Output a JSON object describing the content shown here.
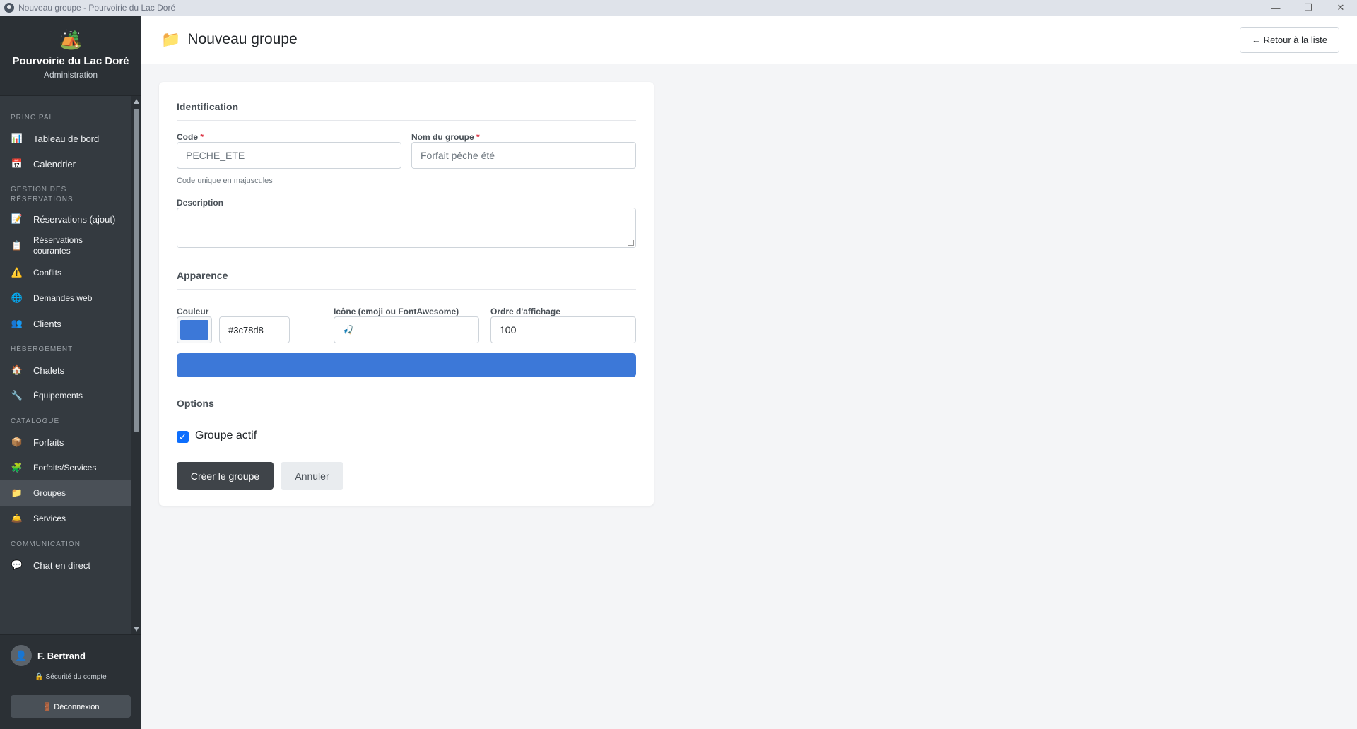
{
  "window": {
    "title": "Nouveau groupe - Pourvoirie du Lac Doré",
    "minimize": "—",
    "maximize": "❐",
    "close": "✕"
  },
  "brand": {
    "logo": "🏕️",
    "name": "Pourvoirie du Lac Doré",
    "subtitle": "Administration"
  },
  "sidebar": {
    "sections": {
      "principal": "PRINCIPAL",
      "reservations": "GESTION DES RÉSERVATIONS",
      "hebergement": "HÉBERGEMENT",
      "catalogue": "CATALOGUE",
      "communication": "COMMUNICATION"
    },
    "items": {
      "dashboard": {
        "icon": "📊",
        "label": "Tableau de bord"
      },
      "calendar": {
        "icon": "📅",
        "label": "Calendrier"
      },
      "reservations_add": {
        "icon": "📝",
        "label": "Réservations (ajout)"
      },
      "reservations_current": {
        "icon": "📋",
        "label": "Réservations courantes"
      },
      "conflicts": {
        "icon": "⚠️",
        "label": "Conflits"
      },
      "web_requests": {
        "icon": "🌐",
        "label": "Demandes web"
      },
      "clients": {
        "icon": "👥",
        "label": "Clients"
      },
      "chalets": {
        "icon": "🏠",
        "label": "Chalets"
      },
      "equipment": {
        "icon": "🔧",
        "label": "Équipements"
      },
      "packages": {
        "icon": "📦",
        "label": "Forfaits"
      },
      "packages_services": {
        "icon": "🧩",
        "label": "Forfaits/Services"
      },
      "groups": {
        "icon": "📁",
        "label": "Groupes"
      },
      "services": {
        "icon": "🛎️",
        "label": "Services"
      },
      "live_chat": {
        "icon": "💬",
        "label": "Chat en direct"
      }
    },
    "user": {
      "avatar": "👤",
      "name": "F. Bertrand",
      "security": "🔒 Sécurité du compte",
      "logout": "🚪 Déconnexion"
    }
  },
  "header": {
    "icon": "📁",
    "title": "Nouveau groupe",
    "back_label": "← Retour à la liste"
  },
  "form": {
    "identification_title": "Identification",
    "code_label": "Code",
    "code_placeholder": "PECHE_ETE",
    "code_hint": "Code unique en majuscules",
    "name_label": "Nom du groupe",
    "name_placeholder": "Forfait pêche été",
    "required_mark": "*",
    "description_label": "Description",
    "description_value": "",
    "appearance_title": "Apparence",
    "color_label": "Couleur",
    "color_value": "#3c78d8",
    "icon_label": "Icône (emoji ou FontAwesome)",
    "icon_value": "🎣",
    "order_label": "Ordre d'affichage",
    "order_value": "100",
    "options_title": "Options",
    "active_label": "Groupe actif",
    "active_checked": true,
    "submit_label": "Créer le groupe",
    "cancel_label": "Annuler"
  },
  "colors": {
    "accent": "#3c78d8",
    "sidebar": "#343a40",
    "primary_button": "#3f4449"
  }
}
